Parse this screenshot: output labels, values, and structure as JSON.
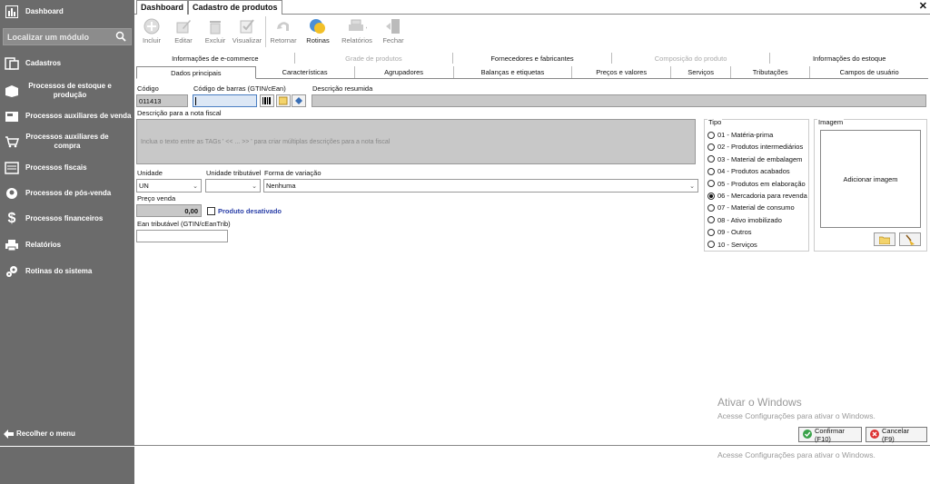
{
  "sidebar": {
    "dashboard": "Dashboard",
    "search_placeholder": "Localizar um módulo",
    "items": [
      {
        "label": "Cadastros"
      },
      {
        "label": "Processos de estoque e produção"
      },
      {
        "label": "Processos auxiliares de venda"
      },
      {
        "label": "Processos auxiliares de compra"
      },
      {
        "label": "Processos fiscais"
      },
      {
        "label": "Processos de pós-venda"
      },
      {
        "label": "Processos financeiros"
      },
      {
        "label": "Relatórios"
      },
      {
        "label": "Rotinas do sistema"
      }
    ],
    "collapse": "Recolher o menu"
  },
  "tabs": {
    "dashboard": "Dashboard",
    "cadastro": "Cadastro de produtos",
    "close": "✕"
  },
  "toolbar": {
    "incluir": "Incluir",
    "editar": "Editar",
    "excluir": "Excluir",
    "visualizar": "Visualizar",
    "retornar": "Retornar",
    "rotinas": "Rotinas",
    "relatorios": "Relatórios",
    "fechar": "Fechar"
  },
  "section_tabs_row1": [
    "Informações de e-commerce",
    "Grade de produtos",
    "Fornecedores e fabricantes",
    "Composição do produto",
    "Informações do estoque"
  ],
  "section_tabs_row2": [
    "Dados principais",
    "Características",
    "Agrupadores",
    "Balanças e etiquetas",
    "Preços e valores",
    "Serviços",
    "Tributações",
    "Campos de usuário"
  ],
  "form": {
    "codigo_label": "Código",
    "codigo_value": "011413",
    "barras_label": "Código de barras (GTIN/cEan)",
    "descricao_resumida_label": "Descrição resumida",
    "descricao_nf_label": "Descrição para a nota fiscal",
    "descricao_nf_placeholder": "Inclua o texto entre as TAGs ' << ... >> ' para criar múltiplas descrições para a nota fiscal",
    "unidade_label": "Unidade",
    "unidade_value": "UN",
    "unidade_trib_label": "Unidade tributável",
    "forma_variacao_label": "Forma de variação",
    "forma_variacao_value": "Nenhuma",
    "preco_label": "Preço venda",
    "preco_value": "0,00",
    "produto_desativado": "Produto desativado",
    "ean_trib_label": "Ean tributável (GTIN/cEanTrib)"
  },
  "tipo": {
    "label": "Tipo",
    "options": [
      "01 - Matéria-prima",
      "02 - Produtos intermediários",
      "03 - Material de embalagem",
      "04 - Produtos acabados",
      "05 - Produtos em elaboração",
      "06 - Mercadoria para revenda",
      "07 - Material de consumo",
      "08 - Ativo imobilizado",
      "09 - Outros",
      "10 - Serviços"
    ],
    "selected_index": 5
  },
  "imagem": {
    "label": "Imagem",
    "add": "Adicionar imagem"
  },
  "footer": {
    "confirmar": "Confirmar (F10)",
    "cancelar": "Cancelar (F9)"
  },
  "watermark": {
    "title": "Ativar o Windows",
    "line": "Acesse Configurações para ativar o Windows.",
    "line2": "Acesse Configurações para ativar o Windows."
  }
}
